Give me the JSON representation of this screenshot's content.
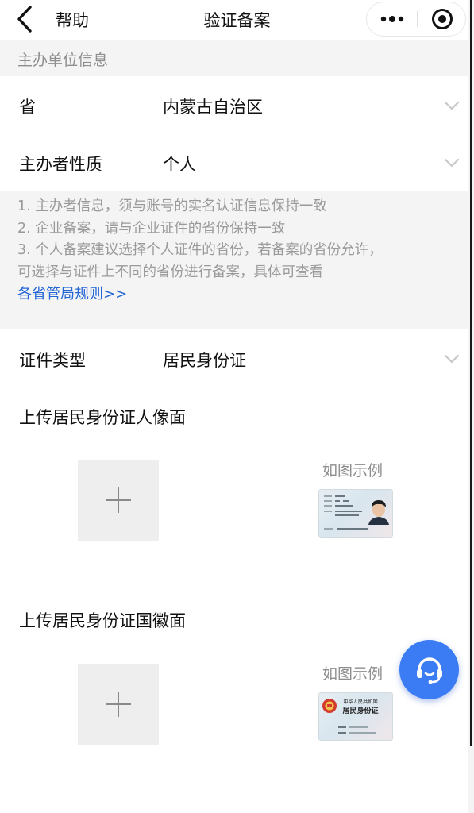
{
  "nav": {
    "help_label": "帮助",
    "title": "验证备案"
  },
  "section_header": "主办单位信息",
  "province": {
    "label": "省",
    "value": "内蒙古自治区"
  },
  "sponsor_nature": {
    "label": "主办者性质",
    "value": "个人"
  },
  "notes": {
    "lines": [
      "1. 主办者信息，须与账号的实名认证信息保持一致",
      "2. 企业备案，请与企业证件的省份保持一致",
      "3. 个人备案建议选择个人证件的省份，若备案的省份允许，",
      "可选择与证件上不同的省份进行备案，具体可查看"
    ],
    "link": "各省管局规则>>"
  },
  "id_type": {
    "label": "证件类型",
    "value": "居民身份证"
  },
  "upload_front": {
    "title": "上传居民身份证人像面",
    "example_label": "如图示例"
  },
  "upload_back": {
    "title": "上传居民身份证国徽面",
    "example_label": "如图示例",
    "card_header_line1": "中华人民共和国",
    "card_header_line2": "居民身份证"
  },
  "colors": {
    "link": "#2466d6",
    "fab": "#3b7cf5",
    "section_bg": "#f4f4f4"
  },
  "icons": {
    "back": "chevron-left-icon",
    "more": "more-dots-icon",
    "close": "target-circle-icon",
    "select": "chevron-down-icon",
    "add": "plus-icon",
    "support": "headset-icon"
  }
}
